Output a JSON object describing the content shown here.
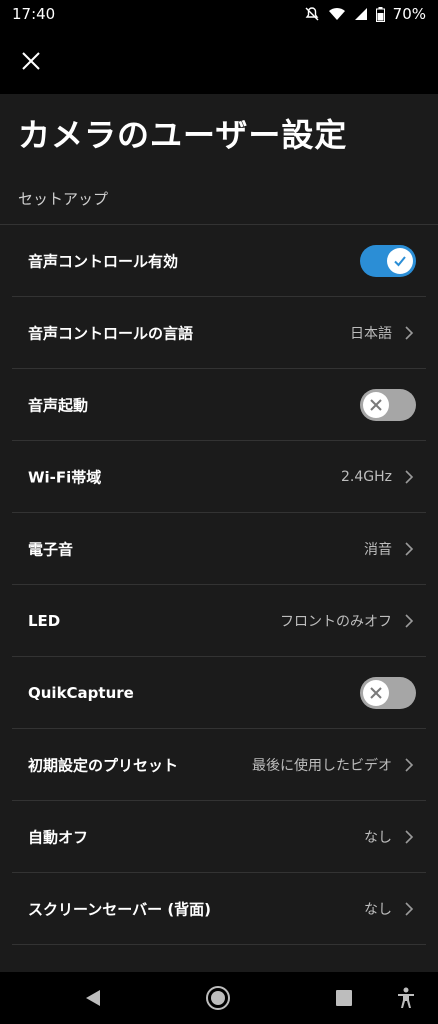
{
  "status_bar": {
    "time": "17:40",
    "battery": "70%",
    "icons": [
      "mute-icon",
      "wifi-icon",
      "signal-icon",
      "battery-icon"
    ]
  },
  "header": {
    "close_icon": "close-icon"
  },
  "page": {
    "title": "カメラのユーザー設定"
  },
  "section": {
    "title": "セットアップ"
  },
  "settings": [
    {
      "label": "音声コントロール有効",
      "type": "toggle",
      "state": "on"
    },
    {
      "label": "音声コントロールの言語",
      "type": "value",
      "value": "日本語"
    },
    {
      "label": "音声起動",
      "type": "toggle",
      "state": "off"
    },
    {
      "label": "Wi-Fi帯域",
      "type": "value",
      "value": "2.4GHz"
    },
    {
      "label": "電子音",
      "type": "value",
      "value": "消音"
    },
    {
      "label": "LED",
      "type": "value",
      "value": "フロントのみオフ"
    },
    {
      "label": "QuikCapture",
      "type": "toggle",
      "state": "off"
    },
    {
      "label": "初期設定のプリセット",
      "type": "value",
      "value": "最後に使用したビデオ"
    },
    {
      "label": "自動オフ",
      "type": "value",
      "value": "なし"
    },
    {
      "label": "スクリーンセーバー (背面)",
      "type": "value",
      "value": "なし"
    }
  ],
  "colors": {
    "accent": "#2b8ed6",
    "toggle_off": "#a6a6a6",
    "background": "#1b1b1b"
  },
  "nav_bar": {
    "icons": [
      "back-icon",
      "home-icon",
      "recents-icon",
      "accessibility-icon"
    ]
  }
}
